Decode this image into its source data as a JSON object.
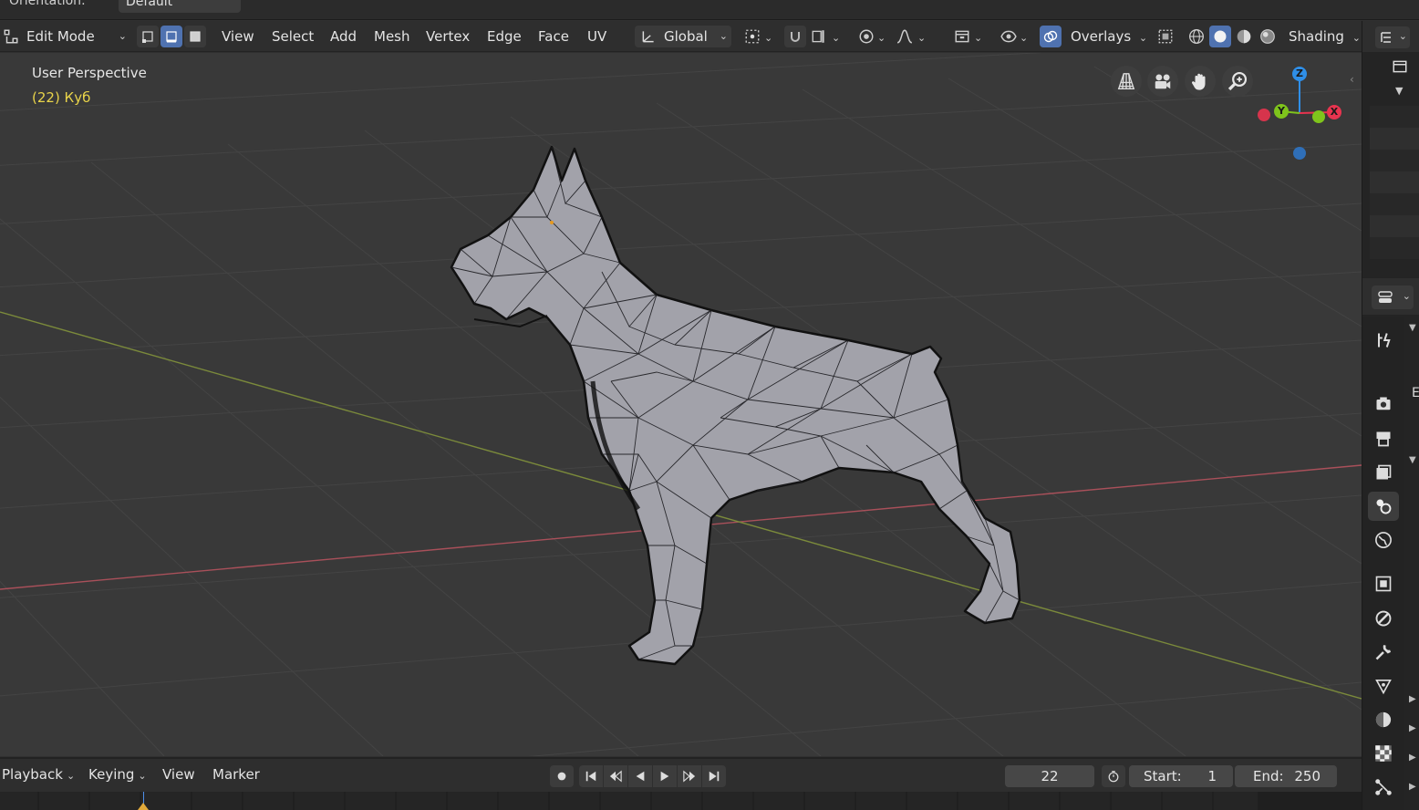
{
  "topbar": {
    "orientation_label": "Orientation:",
    "orientation_value": "Default"
  },
  "header": {
    "mode": "Edit Mode",
    "menus": [
      "View",
      "Select",
      "Add",
      "Mesh",
      "Vertex",
      "Edge",
      "Face",
      "UV"
    ],
    "transform_orientation": "Global",
    "overlays_label": "Overlays",
    "shading_label": "Shading"
  },
  "viewport": {
    "title": "User Perspective",
    "object_info": "(22) Куб"
  },
  "gizmo": {
    "z": "Z",
    "y": "Y",
    "x": "X"
  },
  "right_panel": {
    "cut_letter": "E"
  },
  "timeline": {
    "menus": [
      "Playback",
      "Keying",
      "View",
      "Marker"
    ],
    "current_frame": "22",
    "start_label": "Start:",
    "start_value": "1",
    "end_label": "End:",
    "end_value": "250"
  },
  "colors": {
    "accent_blue": "#4f72b0",
    "axis_x": "#e8344f",
    "axis_y": "#7fc41c",
    "axis_z": "#2f8fe8",
    "object_text": "#e9d44a",
    "viewport_bg": "#393939"
  }
}
